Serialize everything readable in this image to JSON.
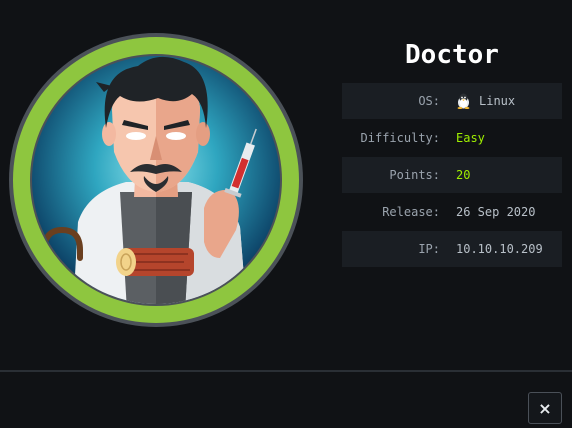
{
  "machine": {
    "name": "Doctor",
    "avatar_icon": "doctor-avatar-icon",
    "ring_color": "#8ec63f",
    "difficulty_color": "#9fef00"
  },
  "info": {
    "os": {
      "label": "OS:",
      "value": "Linux",
      "icon": "linux-penguin-icon"
    },
    "difficulty": {
      "label": "Difficulty:",
      "value": "Easy"
    },
    "points": {
      "label": "Points:",
      "value": "20"
    },
    "release": {
      "label": "Release:",
      "value": "26 Sep 2020"
    },
    "ip": {
      "label": "IP:",
      "value": "10.10.10.209"
    }
  },
  "footer": {
    "close_label": "×",
    "close_icon": "close-icon"
  }
}
